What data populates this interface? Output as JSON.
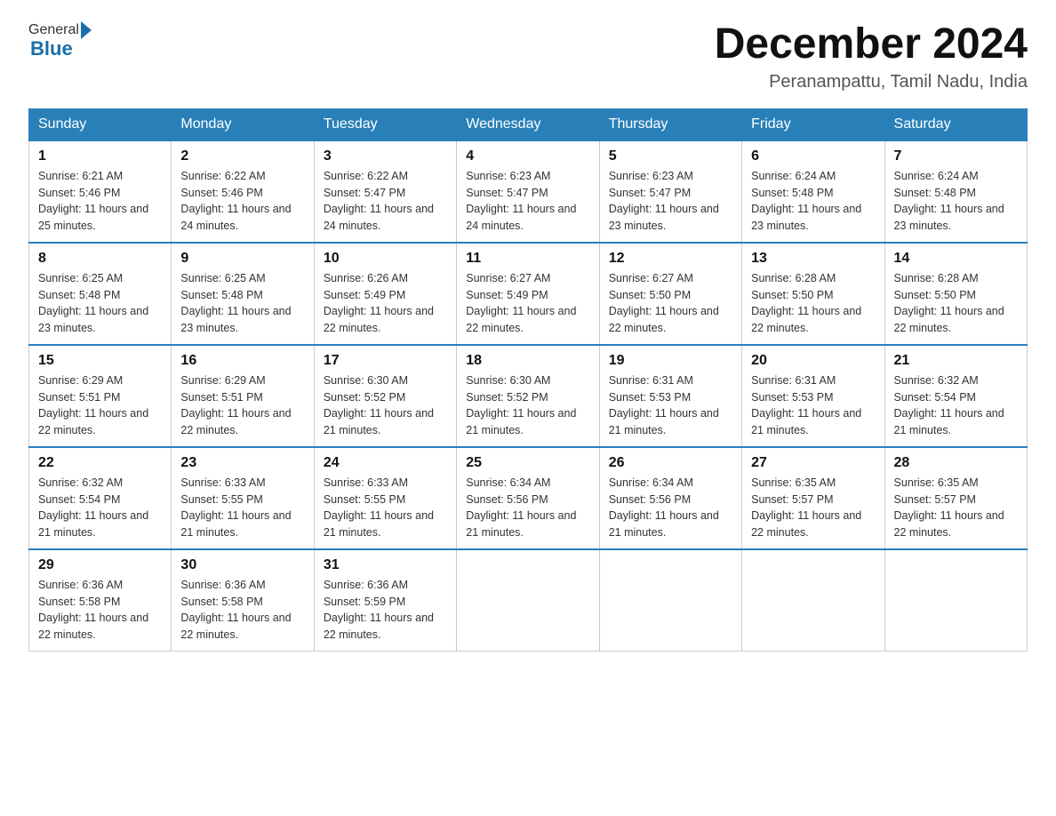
{
  "header": {
    "logo_general": "General",
    "logo_blue": "Blue",
    "month_title": "December 2024",
    "location": "Peranampattu, Tamil Nadu, India"
  },
  "weekdays": [
    "Sunday",
    "Monday",
    "Tuesday",
    "Wednesday",
    "Thursday",
    "Friday",
    "Saturday"
  ],
  "weeks": [
    [
      {
        "day": "1",
        "sunrise": "6:21 AM",
        "sunset": "5:46 PM",
        "daylight": "11 hours and 25 minutes."
      },
      {
        "day": "2",
        "sunrise": "6:22 AM",
        "sunset": "5:46 PM",
        "daylight": "11 hours and 24 minutes."
      },
      {
        "day": "3",
        "sunrise": "6:22 AM",
        "sunset": "5:47 PM",
        "daylight": "11 hours and 24 minutes."
      },
      {
        "day": "4",
        "sunrise": "6:23 AM",
        "sunset": "5:47 PM",
        "daylight": "11 hours and 24 minutes."
      },
      {
        "day": "5",
        "sunrise": "6:23 AM",
        "sunset": "5:47 PM",
        "daylight": "11 hours and 23 minutes."
      },
      {
        "day": "6",
        "sunrise": "6:24 AM",
        "sunset": "5:48 PM",
        "daylight": "11 hours and 23 minutes."
      },
      {
        "day": "7",
        "sunrise": "6:24 AM",
        "sunset": "5:48 PM",
        "daylight": "11 hours and 23 minutes."
      }
    ],
    [
      {
        "day": "8",
        "sunrise": "6:25 AM",
        "sunset": "5:48 PM",
        "daylight": "11 hours and 23 minutes."
      },
      {
        "day": "9",
        "sunrise": "6:25 AM",
        "sunset": "5:48 PM",
        "daylight": "11 hours and 23 minutes."
      },
      {
        "day": "10",
        "sunrise": "6:26 AM",
        "sunset": "5:49 PM",
        "daylight": "11 hours and 22 minutes."
      },
      {
        "day": "11",
        "sunrise": "6:27 AM",
        "sunset": "5:49 PM",
        "daylight": "11 hours and 22 minutes."
      },
      {
        "day": "12",
        "sunrise": "6:27 AM",
        "sunset": "5:50 PM",
        "daylight": "11 hours and 22 minutes."
      },
      {
        "day": "13",
        "sunrise": "6:28 AM",
        "sunset": "5:50 PM",
        "daylight": "11 hours and 22 minutes."
      },
      {
        "day": "14",
        "sunrise": "6:28 AM",
        "sunset": "5:50 PM",
        "daylight": "11 hours and 22 minutes."
      }
    ],
    [
      {
        "day": "15",
        "sunrise": "6:29 AM",
        "sunset": "5:51 PM",
        "daylight": "11 hours and 22 minutes."
      },
      {
        "day": "16",
        "sunrise": "6:29 AM",
        "sunset": "5:51 PM",
        "daylight": "11 hours and 22 minutes."
      },
      {
        "day": "17",
        "sunrise": "6:30 AM",
        "sunset": "5:52 PM",
        "daylight": "11 hours and 21 minutes."
      },
      {
        "day": "18",
        "sunrise": "6:30 AM",
        "sunset": "5:52 PM",
        "daylight": "11 hours and 21 minutes."
      },
      {
        "day": "19",
        "sunrise": "6:31 AM",
        "sunset": "5:53 PM",
        "daylight": "11 hours and 21 minutes."
      },
      {
        "day": "20",
        "sunrise": "6:31 AM",
        "sunset": "5:53 PM",
        "daylight": "11 hours and 21 minutes."
      },
      {
        "day": "21",
        "sunrise": "6:32 AM",
        "sunset": "5:54 PM",
        "daylight": "11 hours and 21 minutes."
      }
    ],
    [
      {
        "day": "22",
        "sunrise": "6:32 AM",
        "sunset": "5:54 PM",
        "daylight": "11 hours and 21 minutes."
      },
      {
        "day": "23",
        "sunrise": "6:33 AM",
        "sunset": "5:55 PM",
        "daylight": "11 hours and 21 minutes."
      },
      {
        "day": "24",
        "sunrise": "6:33 AM",
        "sunset": "5:55 PM",
        "daylight": "11 hours and 21 minutes."
      },
      {
        "day": "25",
        "sunrise": "6:34 AM",
        "sunset": "5:56 PM",
        "daylight": "11 hours and 21 minutes."
      },
      {
        "day": "26",
        "sunrise": "6:34 AM",
        "sunset": "5:56 PM",
        "daylight": "11 hours and 21 minutes."
      },
      {
        "day": "27",
        "sunrise": "6:35 AM",
        "sunset": "5:57 PM",
        "daylight": "11 hours and 22 minutes."
      },
      {
        "day": "28",
        "sunrise": "6:35 AM",
        "sunset": "5:57 PM",
        "daylight": "11 hours and 22 minutes."
      }
    ],
    [
      {
        "day": "29",
        "sunrise": "6:36 AM",
        "sunset": "5:58 PM",
        "daylight": "11 hours and 22 minutes."
      },
      {
        "day": "30",
        "sunrise": "6:36 AM",
        "sunset": "5:58 PM",
        "daylight": "11 hours and 22 minutes."
      },
      {
        "day": "31",
        "sunrise": "6:36 AM",
        "sunset": "5:59 PM",
        "daylight": "11 hours and 22 minutes."
      },
      null,
      null,
      null,
      null
    ]
  ]
}
